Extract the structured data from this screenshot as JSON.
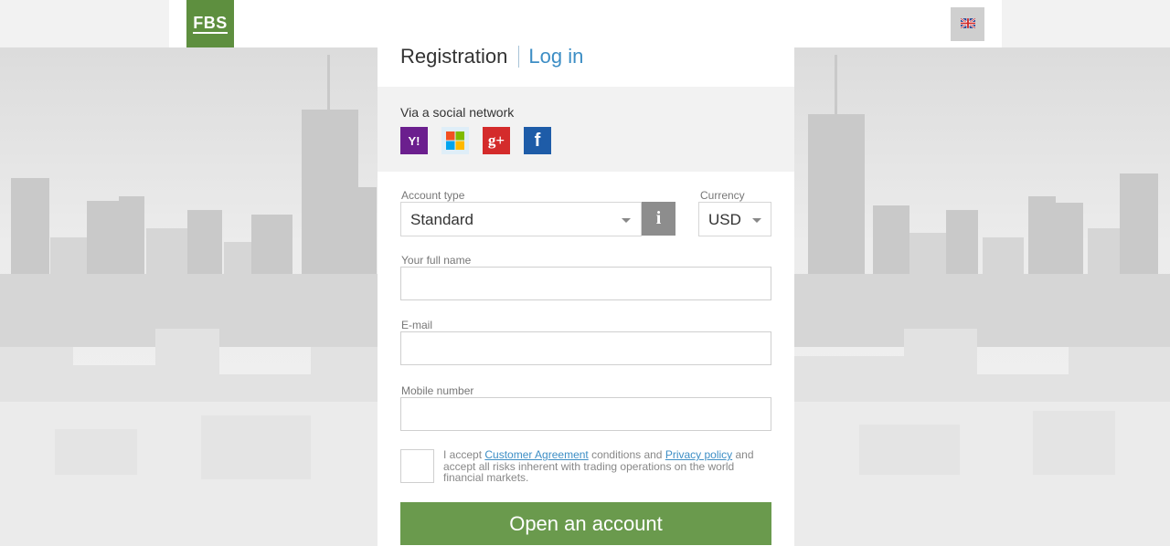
{
  "header": {
    "logo_text": "FBS",
    "language_flag": "uk-flag-icon"
  },
  "tabs": {
    "registration": "Registration",
    "login": "Log in"
  },
  "social": {
    "label": "Via a social network",
    "networks": [
      "yahoo-icon",
      "microsoft-icon",
      "google-plus-icon",
      "facebook-icon"
    ],
    "yahoo_glyph": "Y!",
    "google_glyph": "g+",
    "facebook_glyph": "f"
  },
  "form": {
    "account_type_label": "Account type",
    "account_type_value": "Standard",
    "info_glyph": "i",
    "currency_label": "Currency",
    "currency_value": "USD",
    "full_name_label": "Your full name",
    "full_name_value": "",
    "email_label": "E-mail",
    "email_value": "",
    "mobile_label": "Mobile number",
    "mobile_value": "",
    "terms": {
      "part1": "I accept ",
      "customer_agreement": "Customer Agreement",
      "part2": " conditions and ",
      "privacy_policy": "Privacy policy",
      "part3": " and accept all risks inherent with trading operations on the world financial markets."
    },
    "submit_label": "Open an account"
  },
  "colors": {
    "brand_green": "#5e8f3f",
    "button_green": "#6a9a4d",
    "link_blue": "#3d8ec5"
  }
}
